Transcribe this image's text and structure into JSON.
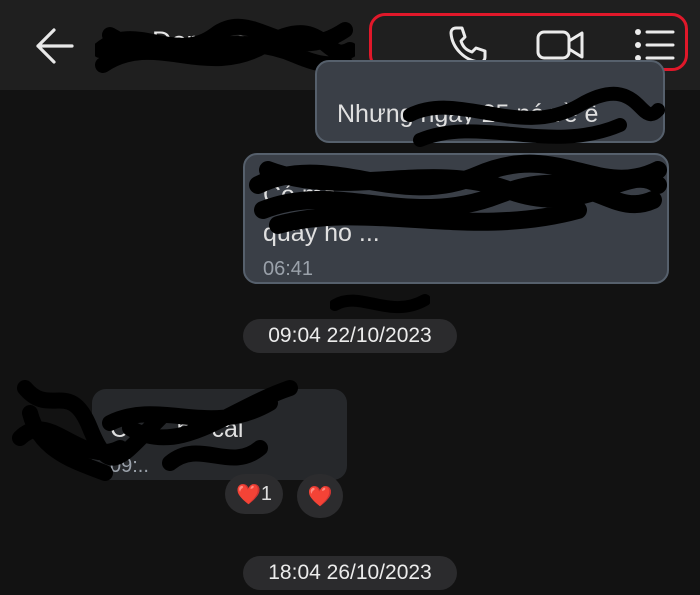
{
  "header": {
    "contact_name": "Nu Doremaster",
    "back_icon": "arrow-left-icon",
    "actions": [
      {
        "name": "voice-call-button",
        "icon": "phone-icon"
      },
      {
        "name": "video-call-button",
        "icon": "video-camera-icon"
      },
      {
        "name": "menu-button",
        "icon": "list-menu-icon"
      }
    ],
    "highlight_color": "#e0182a"
  },
  "messages": [
    {
      "side": "outgoing",
      "text": "Nhưng ngày 25 nó về ế"
    },
    {
      "side": "outgoing",
      "text_line1": "Có ma ...",
      "text_line2": "quay ho ...",
      "time": "06:41"
    }
  ],
  "date_separators": [
    "09:04 22/10/2023",
    "18:04 26/10/2023"
  ],
  "incoming": {
    "text": "Có ... nó cái",
    "time": "09:..",
    "reactions": [
      {
        "emoji": "❤️",
        "count": "1"
      },
      {
        "emoji": "❤️",
        "count": ""
      }
    ]
  },
  "colors": {
    "background": "#121212",
    "header_bg": "#1f1f1f",
    "outgoing_bubble": "#3a3f47",
    "incoming_bubble": "#26282b",
    "heart": "#e8213a"
  }
}
